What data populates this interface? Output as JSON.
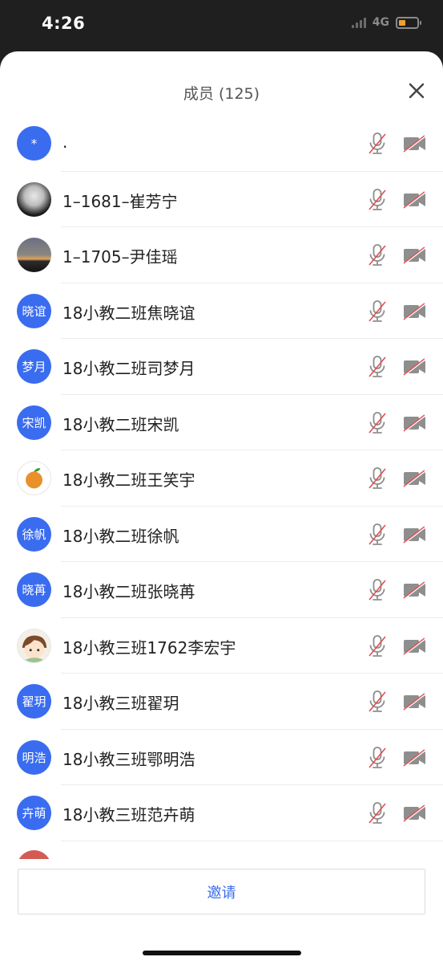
{
  "status_bar": {
    "time": "4:26",
    "network": "4G"
  },
  "sheet": {
    "title": "成员 (125)",
    "invite_label": "邀请"
  },
  "colors": {
    "accent": "#3a6cf0",
    "muted_slash": "#e05050",
    "icon_gray": "#8e8e8e"
  },
  "members": [
    {
      "name": ".",
      "avatar_text": "*",
      "avatar_type": "text",
      "mic": "muted",
      "camera": "off"
    },
    {
      "name": "1–1681–崔芳宁",
      "avatar_text": "",
      "avatar_type": "photo-dark",
      "mic": "muted",
      "camera": "off"
    },
    {
      "name": "1–1705–尹佳瑶",
      "avatar_text": "",
      "avatar_type": "photo-sunset",
      "mic": "muted",
      "camera": "off"
    },
    {
      "name": "18小教二班焦晓谊",
      "avatar_text": "晓谊",
      "avatar_type": "text",
      "mic": "muted",
      "camera": "off"
    },
    {
      "name": "18小教二班司梦月",
      "avatar_text": "梦月",
      "avatar_type": "text",
      "mic": "muted",
      "camera": "off"
    },
    {
      "name": "18小教二班宋凯",
      "avatar_text": "宋凯",
      "avatar_type": "text",
      "mic": "muted",
      "camera": "off"
    },
    {
      "name": "18小教二班王笑宇",
      "avatar_text": "",
      "avatar_type": "orange",
      "mic": "muted",
      "camera": "off"
    },
    {
      "name": "18小教二班徐帆",
      "avatar_text": "徐帆",
      "avatar_type": "text",
      "mic": "muted",
      "camera": "off"
    },
    {
      "name": "18小教二班张晓苒",
      "avatar_text": "晓苒",
      "avatar_type": "text",
      "mic": "muted",
      "camera": "off"
    },
    {
      "name": "18小教三班1762李宏宇",
      "avatar_text": "",
      "avatar_type": "cartoon",
      "mic": "muted",
      "camera": "off"
    },
    {
      "name": "18小教三班翟玥",
      "avatar_text": "翟玥",
      "avatar_type": "text",
      "mic": "muted",
      "camera": "off"
    },
    {
      "name": "18小教三班鄂明浩",
      "avatar_text": "明浩",
      "avatar_type": "text",
      "mic": "muted",
      "camera": "off"
    },
    {
      "name": "18小教三班范卉萌",
      "avatar_text": "卉萌",
      "avatar_type": "text",
      "mic": "muted",
      "camera": "off"
    }
  ]
}
